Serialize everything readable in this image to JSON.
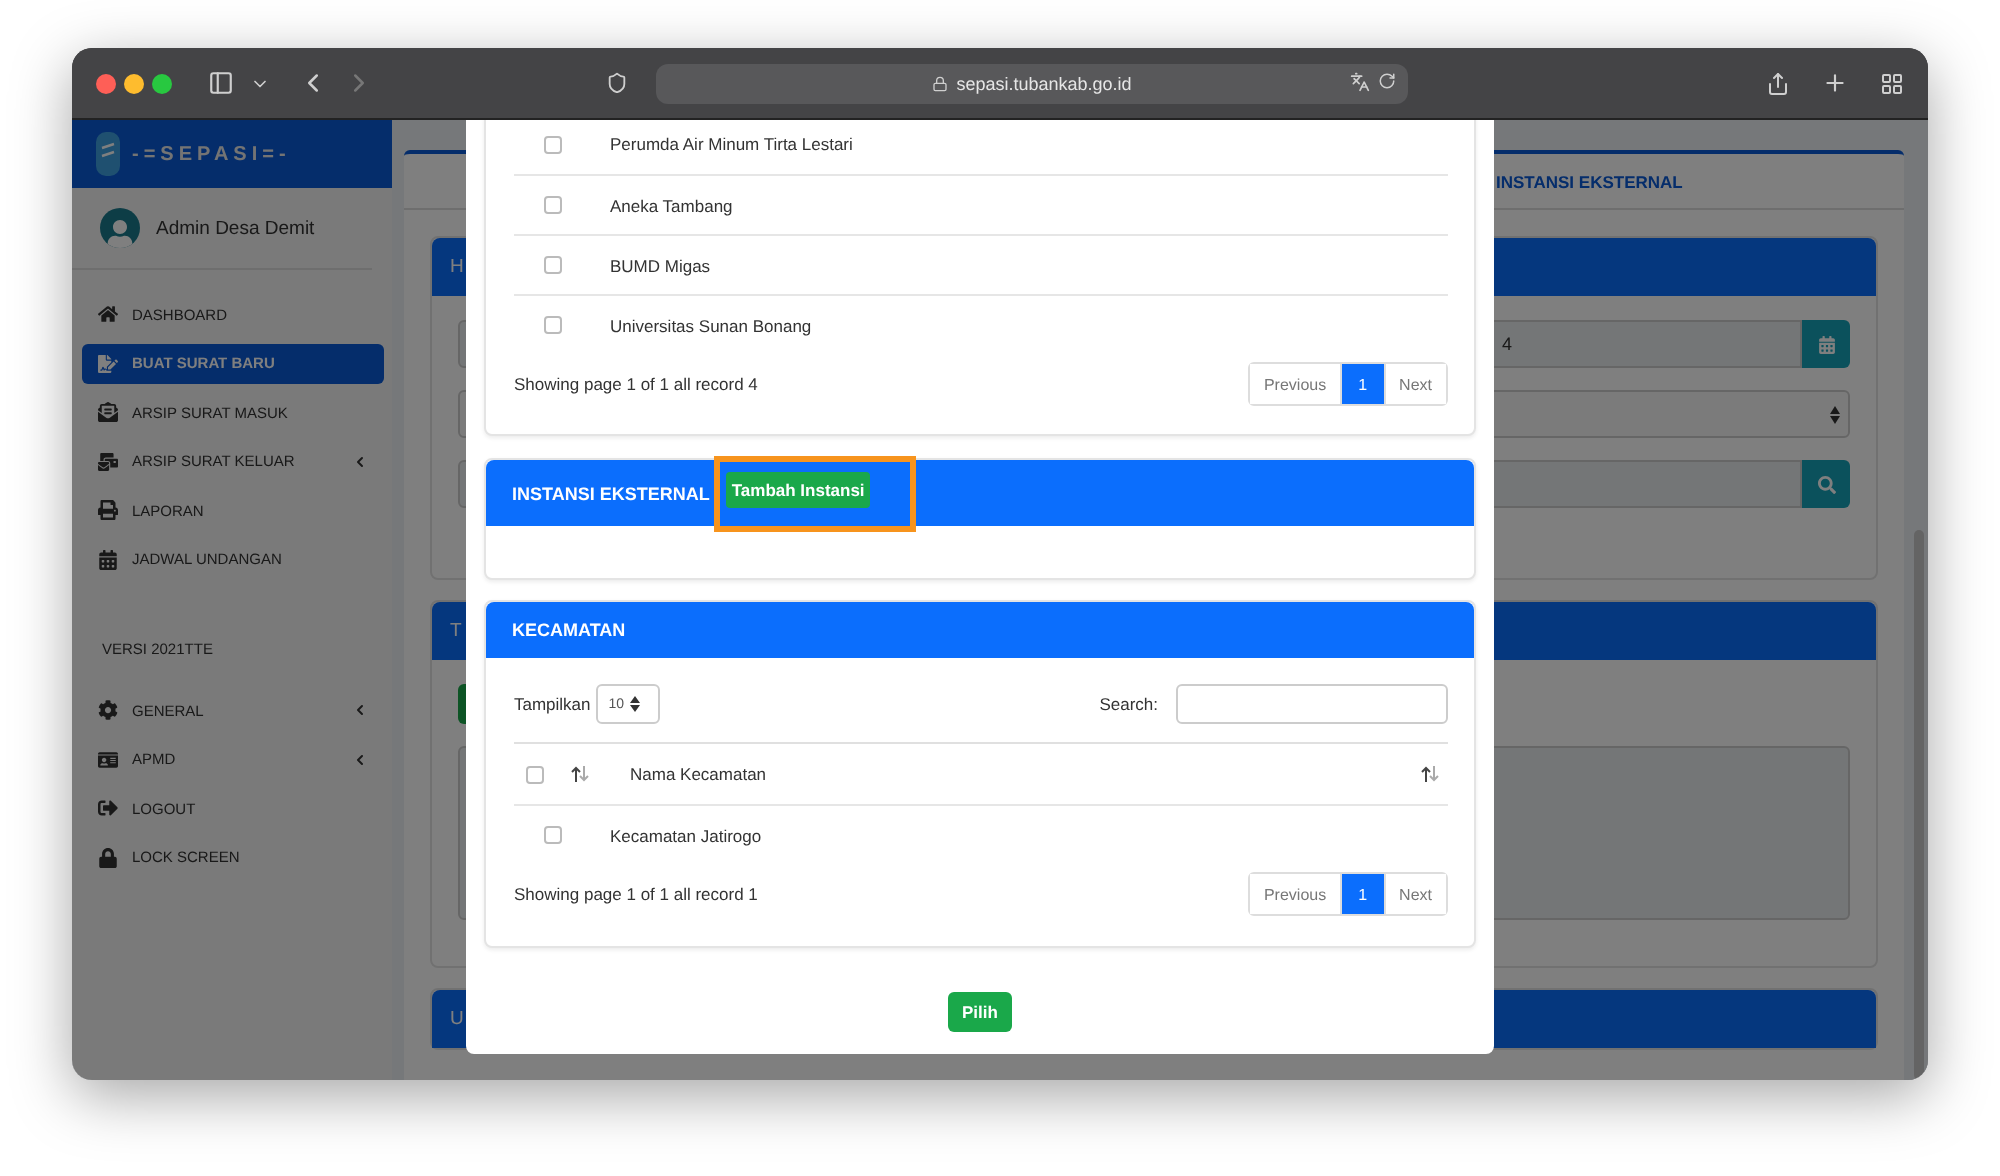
{
  "browser": {
    "url": "sepasi.tubankab.go.id"
  },
  "sidebar": {
    "brand": "-=SEPASI=-",
    "user": "Admin Desa Demit",
    "menu": [
      {
        "label": "DASHBOARD",
        "selected": false,
        "has_submenu": false
      },
      {
        "label": "BUAT SURAT BARU",
        "selected": true,
        "has_submenu": false
      },
      {
        "label": "ARSIP SURAT MASUK",
        "selected": false,
        "has_submenu": false
      },
      {
        "label": "ARSIP SURAT KELUAR",
        "selected": false,
        "has_submenu": true
      },
      {
        "label": "LAPORAN",
        "selected": false,
        "has_submenu": false
      },
      {
        "label": "JADWAL UNDANGAN",
        "selected": false,
        "has_submenu": false
      }
    ],
    "section_label": "VERSI 2021TTE",
    "section_menu": [
      {
        "label": "GENERAL",
        "selected": false,
        "has_submenu": true
      },
      {
        "label": "APMD",
        "selected": false,
        "has_submenu": true
      },
      {
        "label": "LOGOUT",
        "selected": false,
        "has_submenu": false
      },
      {
        "label": "LOCK SCREEN",
        "selected": false,
        "has_submenu": false
      }
    ]
  },
  "page": {
    "tab": "INSTANSI EKSTERNAL",
    "date_value": "4",
    "cards": [
      {
        "title": "H",
        "kind": "form"
      },
      {
        "title": "T",
        "kind": "editor"
      },
      {
        "title": "U",
        "kind": "collapsed"
      }
    ]
  },
  "modal": {
    "instansi_table": {
      "rows": [
        {
          "name": "Perumda Air Minum Tirta Lestari",
          "checked": false
        },
        {
          "name": "Aneka Tambang",
          "checked": false
        },
        {
          "name": "BUMD Migas",
          "checked": false
        },
        {
          "name": "Universitas Sunan Bonang",
          "checked": false
        }
      ],
      "summary": "Showing page 1 of 1 all record 4",
      "pages": [
        {
          "label": "Previous",
          "selected": false
        },
        {
          "label": "1",
          "selected": true
        },
        {
          "label": "Next",
          "selected": false
        }
      ]
    },
    "eksternal": {
      "title": "INSTANSI EKSTERNAL",
      "add_button": "Tambah Instansi"
    },
    "kecamatan": {
      "title": "KECAMATAN",
      "length_label": "Tampilkan",
      "length_value": "10",
      "search_label": "Search:",
      "header_checked": false,
      "column": "Nama Kecamatan",
      "rows": [
        {
          "name": "Kecamatan Jatirogo",
          "checked": false
        }
      ],
      "summary": "Showing page 1 of 1 all record 1",
      "pages": [
        {
          "label": "Previous",
          "selected": false
        },
        {
          "label": "1",
          "selected": true
        },
        {
          "label": "Next",
          "selected": false
        }
      ]
    },
    "submit": "Pilih"
  }
}
